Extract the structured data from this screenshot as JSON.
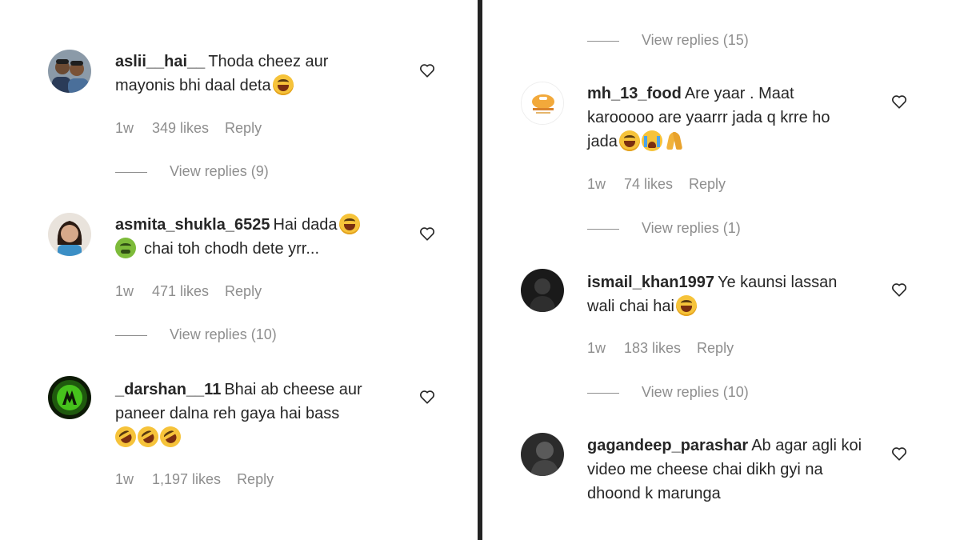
{
  "left": {
    "comments": [
      {
        "username": "aslii__hai__",
        "text": "Thoda cheez aur mayonis bhi daal deta",
        "emojis": [
          "joy"
        ],
        "time": "1w",
        "likes": "349 likes",
        "reply": "Reply",
        "view_replies": "View replies (9)",
        "avatar_icon": "two-people-photo"
      },
      {
        "username": "asmita_shukla_6525",
        "text": "Hai dada",
        "text2": "chai toh chodh dete yrr...",
        "emojis": [
          "joy"
        ],
        "emojis2": [
          "nauseated"
        ],
        "time": "1w",
        "likes": "471 likes",
        "reply": "Reply",
        "view_replies": "View replies (10)",
        "avatar_icon": "girl-photo"
      },
      {
        "username": "_darshan__11",
        "text": "Bhai ab cheese aur paneer dalna reh gaya hai bass",
        "emojis": [
          "rofl",
          "rofl",
          "rofl"
        ],
        "time": "1w",
        "likes": "1,197 likes",
        "reply": "Reply",
        "view_replies": "",
        "avatar_icon": "green-logo"
      }
    ]
  },
  "right": {
    "top_view_replies": "View replies (15)",
    "comments": [
      {
        "username": "mh_13_food",
        "text": "Are yaar . Maat karooooo are yaarrr jada q krre ho jada",
        "emojis": [
          "joy",
          "sob",
          "pray"
        ],
        "time": "1w",
        "likes": "74 likes",
        "reply": "Reply",
        "view_replies": "View replies (1)",
        "avatar_icon": "food-logo"
      },
      {
        "username": "ismail_khan1997",
        "text": "Ye kaunsi lassan wali chai hai",
        "emojis": [
          "joy"
        ],
        "time": "1w",
        "likes": "183 likes",
        "reply": "Reply",
        "view_replies": "View replies (10)",
        "avatar_icon": "dark-photo"
      },
      {
        "username": "gagandeep_parashar",
        "text": "Ab agar agli koi video me cheese chai dikh gyi na dhoond k marunga",
        "emojis": [],
        "avatar_icon": "dark-photo"
      }
    ]
  },
  "icons": {
    "like": "heart-outline-icon"
  },
  "colors": {
    "text": "#262626",
    "muted": "#8e8e8e",
    "divider": "#222222"
  }
}
